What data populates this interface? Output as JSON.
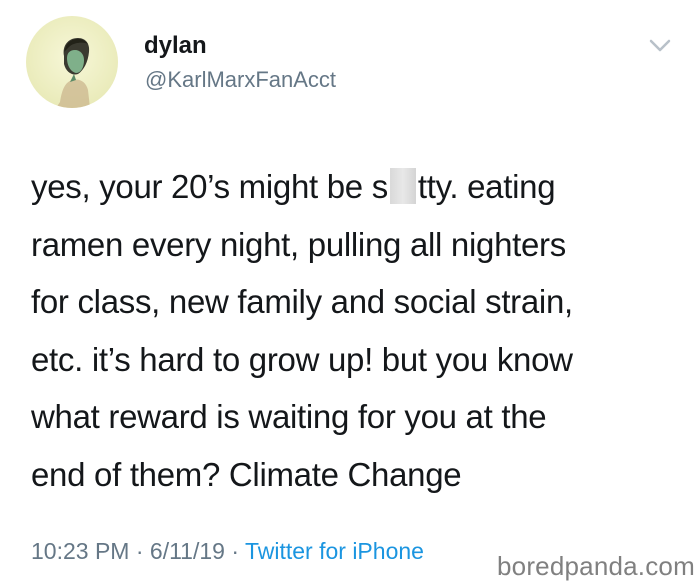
{
  "tweet": {
    "display_name": "dylan",
    "handle": "@KarlMarxFanAcct",
    "body": {
      "line1_before": "yes, your 20’s might be s",
      "line1_after": "tty. eating",
      "line2": "ramen every night, pulling all nighters",
      "line3": "for class, new family and social strain,",
      "line4": "etc. it’s hard to grow up! but you know",
      "line5": "what reward is waiting for you at the",
      "line6": "end of them? Climate Change"
    },
    "time": "10:23 PM",
    "separator": " · ",
    "date": "6/11/19",
    "source": "Twitter for iPhone"
  },
  "icons": {
    "avatar": "avatar",
    "menu": "chevron-down-icon"
  },
  "watermark": "boredpanda.com",
  "colors": {
    "text": "#14171a",
    "secondary": "#657786",
    "link": "#1b95e0"
  }
}
